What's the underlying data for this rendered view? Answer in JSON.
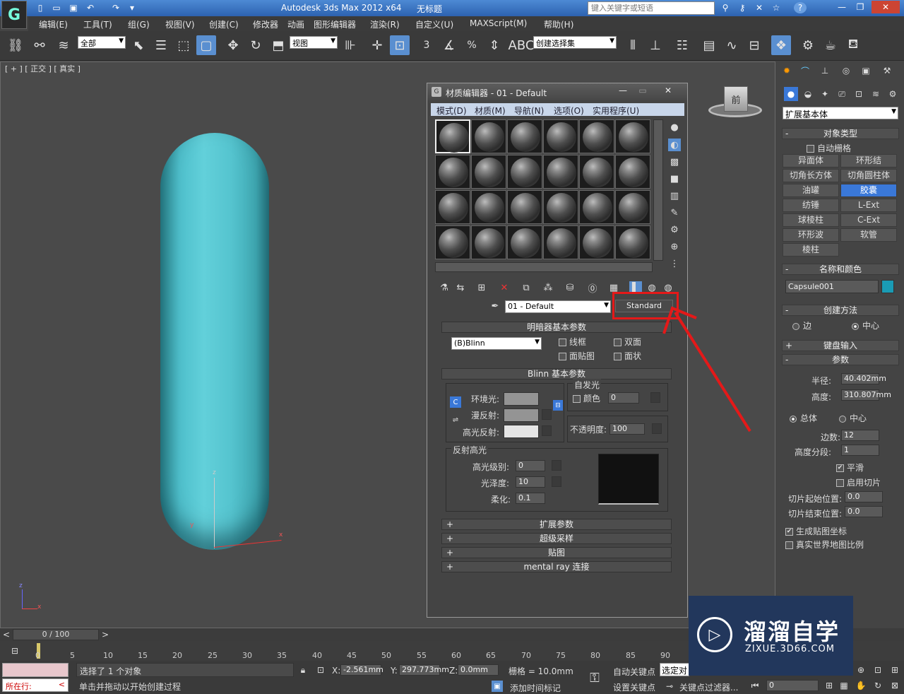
{
  "app": {
    "title": "Autodesk 3ds Max  2012 x64",
    "file": "无标题",
    "search_placeholder": "键入关键字或短语"
  },
  "menu": [
    "编辑(E)",
    "工具(T)",
    "组(G)",
    "视图(V)",
    "创建(C)",
    "修改器",
    "动画",
    "图形编辑器",
    "渲染(R)",
    "自定义(U)",
    "MAXScript(M)",
    "帮助(H)"
  ],
  "toolbar": {
    "selection_filter": "全部",
    "ref_coord": "视图",
    "named_selection": "创建选择集",
    "snap_3d": "3",
    "angle_snap": "%"
  },
  "viewport": {
    "label": "[ + ] [ 正交 ] [ 真实 ]",
    "viewcube_label": "前",
    "axis_x": "x",
    "axis_y": "y",
    "axis_z": "z"
  },
  "material_editor": {
    "title": "材质编辑器 - 01 - Default",
    "menu": [
      "模式(D)",
      "材质(M)",
      "导航(N)",
      "选项(O)",
      "实用程序(U)"
    ],
    "material_name": "01 - Default",
    "material_type": "Standard",
    "shader_section": "明暗器基本参数",
    "shader": "(B)Blinn",
    "shader_opts": [
      "线框",
      "双面",
      "面贴图",
      "面状"
    ],
    "blinn_section": "Blinn 基本参数",
    "self_illum": "自发光",
    "color_label": "颜色",
    "color_value": "0",
    "ambient": "环境光:",
    "diffuse": "漫反射:",
    "specular": "高光反射:",
    "opacity_label": "不透明度:",
    "opacity_value": "100",
    "spec_group": "反射高光",
    "spec_level_label": "高光级别:",
    "spec_level": "0",
    "gloss_label": "光泽度:",
    "gloss": "10",
    "soften_label": "柔化:",
    "soften": "0.1",
    "rollouts": [
      "扩展参数",
      "超级采样",
      "贴图",
      "mental ray 连接"
    ],
    "colors": {
      "ambient": "#949494",
      "diffuse": "#949494",
      "specular": "#e5e5e5"
    }
  },
  "command_panel": {
    "category": "扩展基本体",
    "object_type": "对象类型",
    "autogrid": "自动栅格",
    "buttons": [
      [
        "异面体",
        "环形结"
      ],
      [
        "切角长方体",
        "切角圆柱体"
      ],
      [
        "油罐",
        "胶囊"
      ],
      [
        "纺锤",
        "L-Ext"
      ],
      [
        "球棱柱",
        "C-Ext"
      ],
      [
        "环形波",
        "软管"
      ],
      [
        "棱柱",
        ""
      ]
    ],
    "active_button": "胶囊",
    "name_color": "名称和颜色",
    "object_name": "Capsule001",
    "object_color": "#1a9bb4",
    "creation_method": "创建方法",
    "edge": "边",
    "center": "中心",
    "keyboard": "键盘输入",
    "params": "参数",
    "radius_label": "半径:",
    "radius": "40.402mm",
    "height_label": "高度:",
    "height": "310.807mm",
    "overall": "总体",
    "centers": "中心",
    "sides_label": "边数:",
    "sides": "12",
    "hsegs_label": "高度分段:",
    "hsegs": "1",
    "smooth": "平滑",
    "slice_on": "启用切片",
    "slice_from_label": "切片起始位置:",
    "slice_from": "0.0",
    "slice_to_label": "切片结束位置:",
    "slice_to": "0.0",
    "gen_map": "生成贴图坐标",
    "real_world": "真实世界地图比例"
  },
  "timeline": {
    "frame": "0 / 100",
    "ticks": [
      "0",
      "5",
      "10",
      "15",
      "20",
      "25",
      "30",
      "35",
      "40",
      "45",
      "50",
      "55",
      "60",
      "65",
      "70",
      "75",
      "80",
      "85",
      "90"
    ]
  },
  "status": {
    "selected": "选择了 1 个对象",
    "prompt": "单击并拖动以开始创建过程",
    "running": "所在行:",
    "x_label": "X:",
    "x": "-2.561mm",
    "y_label": "Y:",
    "y": "297.773mm",
    "z_label": "Z:",
    "z": "0.0mm",
    "grid": "栅格 = 10.0mm",
    "auto_key": "自动关键点",
    "selected_obj": "选定对",
    "set_key": "设置关键点",
    "key_filters": "关键点过滤器...",
    "add_time_tag": "添加时间标记",
    "frame_spinner": "0"
  },
  "watermark": {
    "brand": "溜溜自学",
    "url": "ZIXUE.3D66.COM"
  }
}
